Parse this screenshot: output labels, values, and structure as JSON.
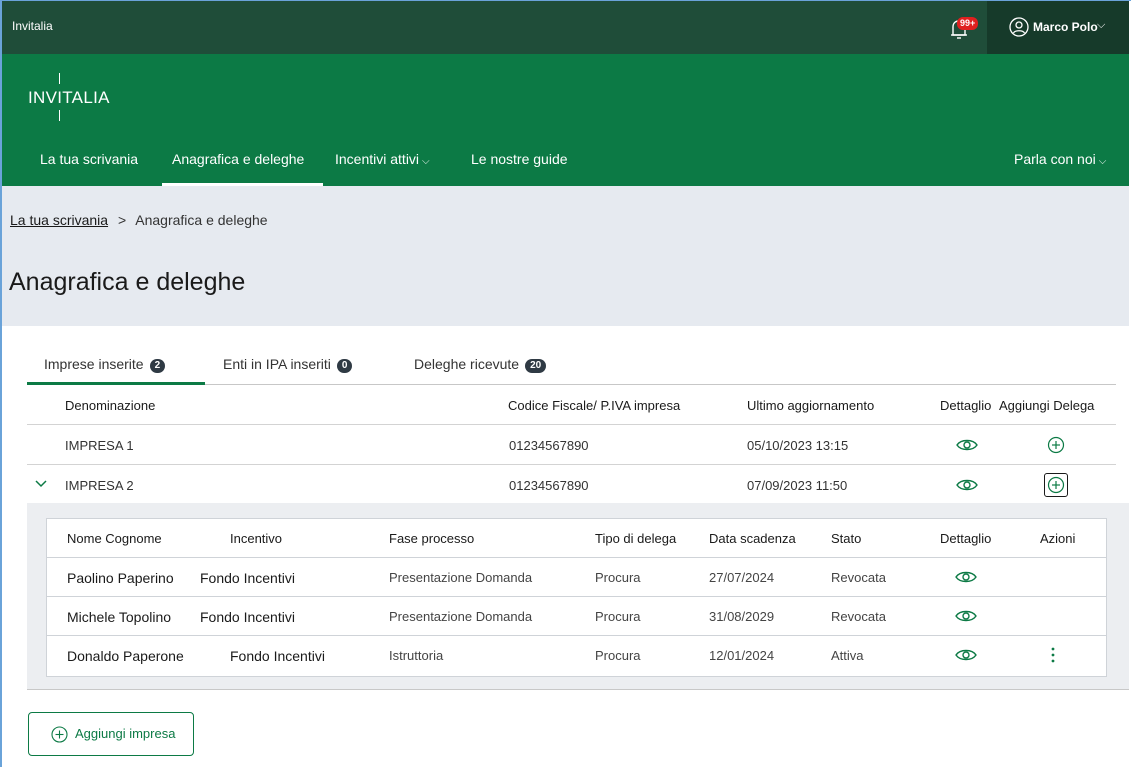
{
  "topbar": {
    "brand": "Invitalia",
    "notifications_badge": "99+",
    "user_name": "Marco Polo"
  },
  "header": {
    "logo_text": "INVITALIA",
    "nav": [
      {
        "label": "La tua scrivania",
        "active": false
      },
      {
        "label": "Anagrafica e deleghe",
        "active": true
      },
      {
        "label": "Incentivi attivi",
        "active": false,
        "dropdown": true
      },
      {
        "label": "Le nostre guide",
        "active": false
      }
    ],
    "right_nav": {
      "label": "Parla con noi",
      "dropdown": true
    }
  },
  "breadcrumb": {
    "link": "La tua scrivania",
    "separator": ">",
    "current": "Anagrafica e deleghe"
  },
  "page_title": "Anagrafica e deleghe",
  "tabs": [
    {
      "label": "Imprese inserite",
      "count": "2",
      "active": true
    },
    {
      "label": "Enti in IPA inseriti",
      "count": "0",
      "active": false
    },
    {
      "label": "Deleghe ricevute",
      "count": "20",
      "active": false
    }
  ],
  "main_table": {
    "headers": {
      "denominazione": "Denominazione",
      "codice": "Codice Fiscale/ P.IVA impresa",
      "ultimo": "Ultimo aggiornamento",
      "dettaglio": "Dettaglio",
      "aggiungi": "Aggiungi Delega"
    },
    "rows": [
      {
        "name": "IMPRESA 1",
        "codice": "01234567890",
        "aggiornamento": "05/10/2023 13:15",
        "expanded": false
      },
      {
        "name": "IMPRESA 2",
        "codice": "01234567890",
        "aggiornamento": "07/09/2023 11:50",
        "expanded": true
      }
    ]
  },
  "nested_table": {
    "headers": {
      "nome": "Nome Cognome",
      "incentivo": "Incentivo",
      "fase": "Fase processo",
      "tipo": "Tipo di delega",
      "scadenza": "Data scadenza",
      "stato": "Stato",
      "dettaglio": "Dettaglio",
      "azioni": "Azioni"
    },
    "rows": [
      {
        "nome": "Paolino Paperino",
        "incentivo": "Fondo Incentivi",
        "fase": "Presentazione Domanda",
        "tipo": "Procura",
        "scadenza": "27/07/2024",
        "stato": "Revocata"
      },
      {
        "nome": "Michele Topolino",
        "incentivo": "Fondo Incentivi",
        "fase": "Presentazione Domanda",
        "tipo": "Procura",
        "scadenza": "31/08/2029",
        "stato": "Revocata"
      },
      {
        "nome": "Donaldo Paperone",
        "incentivo": "Fondo Incentivi",
        "fase": "Istruttoria",
        "tipo": "Procura",
        "scadenza": "12/01/2024",
        "stato": "Attiva"
      }
    ]
  },
  "add_button": {
    "label": "Aggiungi impresa"
  },
  "colors": {
    "topbar": "#1f4d39",
    "header": "#0c7a45",
    "accent": "#0c7a45",
    "badge": "#e0201f"
  }
}
